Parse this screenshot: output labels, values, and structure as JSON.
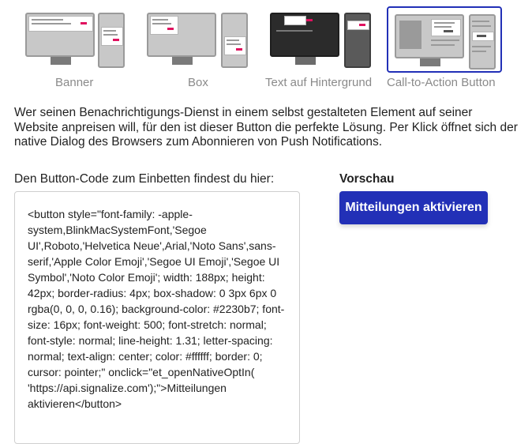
{
  "options": [
    {
      "label": "Banner",
      "icon": "banner-layout-icon",
      "selected": false
    },
    {
      "label": "Box",
      "icon": "box-layout-icon",
      "selected": false
    },
    {
      "label": "Text auf Hintergrund",
      "icon": "text-on-background-layout-icon",
      "selected": false
    },
    {
      "label": "Call-to-Action Button",
      "icon": "call-to-action-layout-icon",
      "selected": true
    }
  ],
  "description": "Wer seinen Benachrichtigungs-Dienst in einem selbst gestalteten Element auf seiner Website anpreisen will, für den ist dieser Button die perfekte Lösung. Per Klick öffnet sich der native Dialog des Browsers zum Abonnieren von Push Notifications.",
  "code_section": {
    "label": "Den Button-Code zum Einbetten findest du hier:",
    "code": "<button style=\"font-family: -apple-system,BlinkMacSystemFont,'Segoe UI',Roboto,'Helvetica Neue',Arial,'Noto Sans',sans-serif,'Apple Color Emoji','Segoe UI Emoji','Segoe UI Symbol','Noto Color Emoji'; width: 188px; height: 42px; border-radius: 4px; box-shadow: 0 3px 6px 0 rgba(0, 0, 0, 0.16); background-color: #2230b7; font-size: 16px; font-weight: 500; font-stretch: normal; font-style: normal; line-height: 1.31; letter-spacing: normal; text-align: center; color: #ffffff; border: 0; cursor: pointer;\" onclick=\"et_openNativeOptIn( 'https://api.signalize.com');\">Mitteilungen aktivieren</button>"
  },
  "preview": {
    "label": "Vorschau",
    "button_label": "Mitteilungen aktivieren"
  },
  "colors": {
    "accent": "#2230b7",
    "highlight": "#e0115f"
  }
}
